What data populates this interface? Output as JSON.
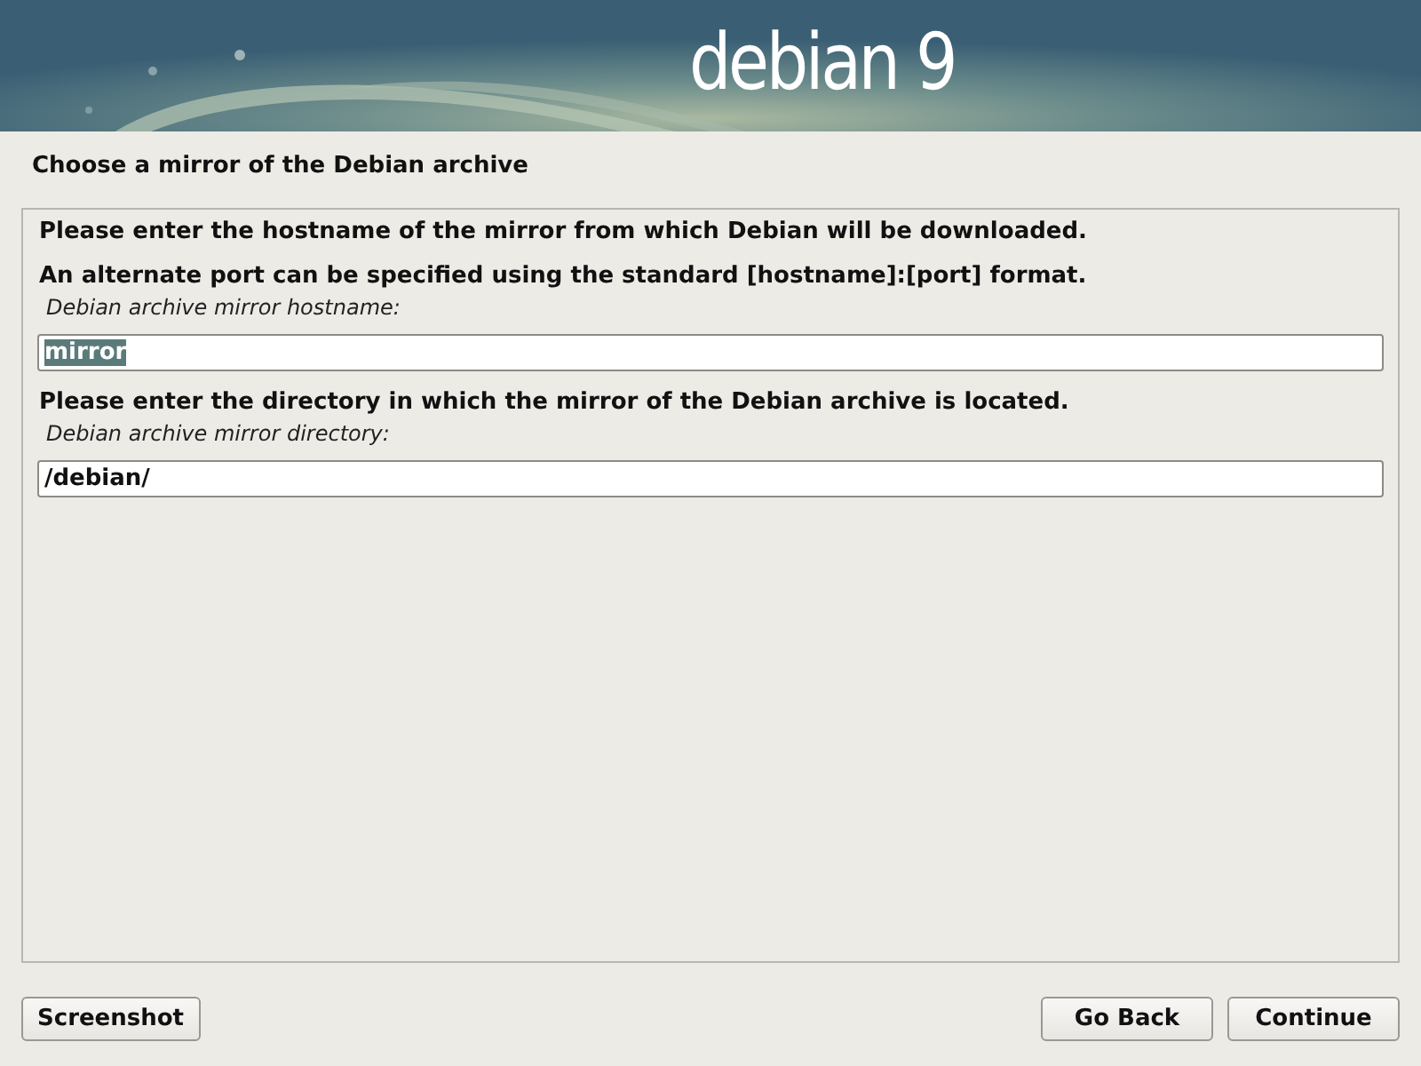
{
  "banner": {
    "logo": "debian 9"
  },
  "title": "Choose a mirror of the Debian archive",
  "questions": [
    {
      "descriptions": [
        "Please enter the hostname of the mirror from which Debian will be downloaded.",
        "An alternate port can be specified using the standard [hostname]:[port] format."
      ],
      "label": "Debian archive mirror hostname:",
      "value": "mirror",
      "text_selected": true
    },
    {
      "descriptions": [
        "Please enter the directory in which the mirror of the Debian archive is located."
      ],
      "label": "Debian archive mirror directory:",
      "value": "/debian/",
      "text_selected": false
    }
  ],
  "buttons": {
    "left": [
      "Screenshot"
    ],
    "right": [
      "Go Back",
      "Continue"
    ]
  }
}
